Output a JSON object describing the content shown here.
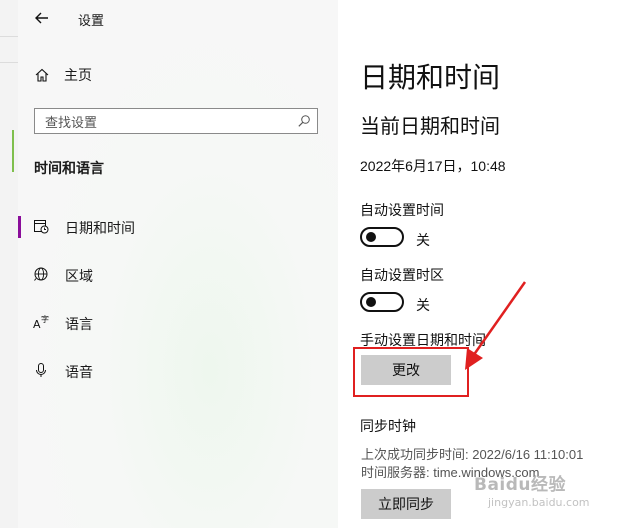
{
  "window": {
    "title": "设置"
  },
  "sidebar": {
    "home_label": "主页",
    "search_placeholder": "查找设置",
    "section_header": "时间和语言",
    "items": [
      {
        "label": "日期和时间",
        "icon": "calendar-clock-icon",
        "active": true
      },
      {
        "label": "区域",
        "icon": "globe-icon",
        "active": false
      },
      {
        "label": "语言",
        "icon": "language-icon",
        "active": false
      },
      {
        "label": "语音",
        "icon": "microphone-icon",
        "active": false
      }
    ]
  },
  "content": {
    "title": "日期和时间",
    "current_heading": "当前日期和时间",
    "current_datetime": "2022年6月17日，10:48",
    "auto_time_label": "自动设置时间",
    "auto_time_state": "关",
    "auto_tz_label": "自动设置时区",
    "auto_tz_state": "关",
    "manual_label": "手动设置日期和时间",
    "change_button": "更改",
    "sync_heading": "同步时钟",
    "last_sync": "上次成功同步时间: 2022/6/16 11:10:01",
    "time_server": "时间服务器: time.windows.com",
    "sync_button": "立即同步"
  },
  "watermark": {
    "text": "Baidu经验",
    "sub": "jingyan.baidu.com"
  },
  "colors": {
    "accent": "#8a0d9a",
    "annotation": "#e02020",
    "button": "#cccccc"
  }
}
